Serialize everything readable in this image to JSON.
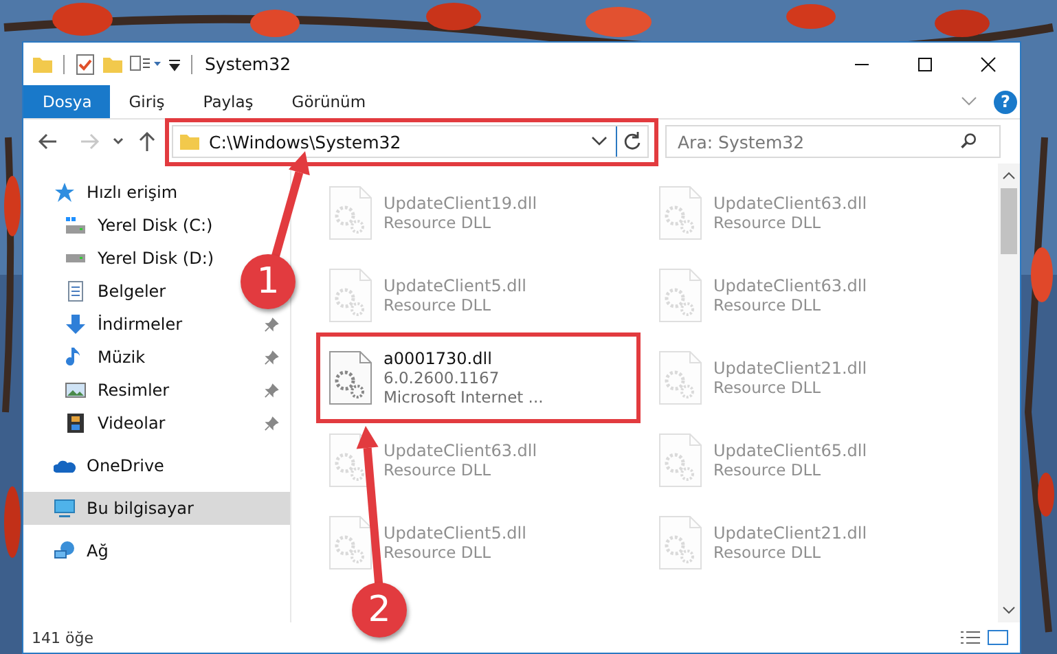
{
  "window": {
    "title": "System32"
  },
  "ribbon": {
    "tabs": [
      {
        "label": "Dosya",
        "selected": true
      },
      {
        "label": "Giriş",
        "selected": false
      },
      {
        "label": "Paylaş",
        "selected": false
      },
      {
        "label": "Görünüm",
        "selected": false
      }
    ],
    "help": "?"
  },
  "address": {
    "path": "C:\\Windows\\System32"
  },
  "search": {
    "placeholder": "Ara: System32"
  },
  "sidebar": {
    "items": [
      {
        "label": "Hızlı erişim",
        "kind": "star",
        "selected": false,
        "children": [
          {
            "label": "Yerel Disk (C:)",
            "kind": "drive-win",
            "pinned": false,
            "selected": false
          },
          {
            "label": "Yerel Disk (D:)",
            "kind": "drive",
            "pinned": false,
            "selected": false
          },
          {
            "label": "Belgeler",
            "kind": "document",
            "pinned": false,
            "selected": false
          },
          {
            "label": "İndirmeler",
            "kind": "download",
            "pinned": true,
            "selected": false
          },
          {
            "label": "Müzik",
            "kind": "music",
            "pinned": true,
            "selected": false
          },
          {
            "label": "Resimler",
            "kind": "pictures",
            "pinned": true,
            "selected": false
          },
          {
            "label": "Videolar",
            "kind": "video",
            "pinned": true,
            "selected": false
          }
        ]
      },
      {
        "label": "OneDrive",
        "kind": "cloud",
        "selected": false
      },
      {
        "label": "Bu bilgisayar",
        "kind": "computer",
        "selected": true
      },
      {
        "label": "Ağ",
        "kind": "network",
        "selected": false
      }
    ]
  },
  "files": [
    {
      "name": "UpdateClient19.dll",
      "detail": "Resource DLL",
      "faded": true
    },
    {
      "name": "UpdateClient63.dll",
      "detail": "Resource DLL",
      "faded": true
    },
    {
      "name": "UpdateClient5.dll",
      "detail": "Resource DLL",
      "faded": true
    },
    {
      "name": "UpdateClient63.dll",
      "detail": "Resource DLL",
      "faded": true
    },
    {
      "name": "a0001730.dll",
      "version": "6.0.2600.1167",
      "detail": "Microsoft Internet ...",
      "faded": false
    },
    {
      "name": "UpdateClient21.dll",
      "detail": "Resource DLL",
      "faded": true
    },
    {
      "name": "UpdateClient63.dll",
      "detail": "Resource DLL",
      "faded": true
    },
    {
      "name": "UpdateClient65.dll",
      "detail": "Resource DLL",
      "faded": true
    },
    {
      "name": "UpdateClient5.dll",
      "detail": "Resource DLL",
      "faded": true
    },
    {
      "name": "UpdateClient21.dll",
      "detail": "Resource DLL",
      "faded": true
    }
  ],
  "status_bar": {
    "count": "141 öğe"
  },
  "annotations": [
    {
      "label": "1"
    },
    {
      "label": "2"
    }
  ]
}
